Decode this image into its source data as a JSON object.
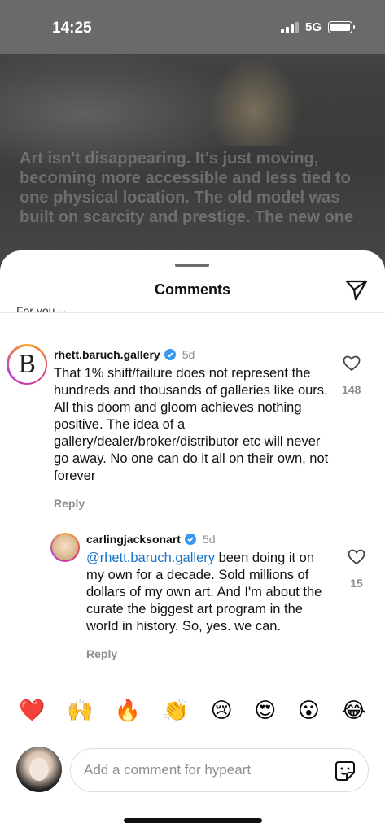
{
  "status_bar": {
    "time": "14:25",
    "network": "5G"
  },
  "post": {
    "caption": "Art isn't disappearing. It's just moving, becoming more accessible and less tied to one physical location. The old model was built on scarcity and prestige. The new one"
  },
  "sheet": {
    "title": "Comments",
    "filter_label": "For you"
  },
  "comments": [
    {
      "username": "rhett.baruch.gallery",
      "time": "5d",
      "text": "That 1% shift/failure does not represent the hundreds and thousands of galleries like ours. All this doom and gloom achieves nothing positive. The idea of a gallery/dealer/broker/distributor etc will never go away. No one can do it all on their own, not forever",
      "reply_label": "Reply",
      "likes": "148",
      "avatar_letter": "B"
    },
    {
      "username": "carlingjacksonart",
      "time": "5d",
      "mention": "@rhett.baruch.gallery",
      "text": " been doing it on my own for a decade. Sold millions of dollars of my own art. And I'm about the curate the biggest art program in the world in history. So, yes. we can.",
      "reply_label": "Reply",
      "likes": "15"
    }
  ],
  "reactions": [
    "❤️",
    "🙌",
    "🔥",
    "👏",
    "😢",
    "😍",
    "😮",
    "😂"
  ],
  "composer": {
    "placeholder": "Add a comment for hypeart"
  }
}
